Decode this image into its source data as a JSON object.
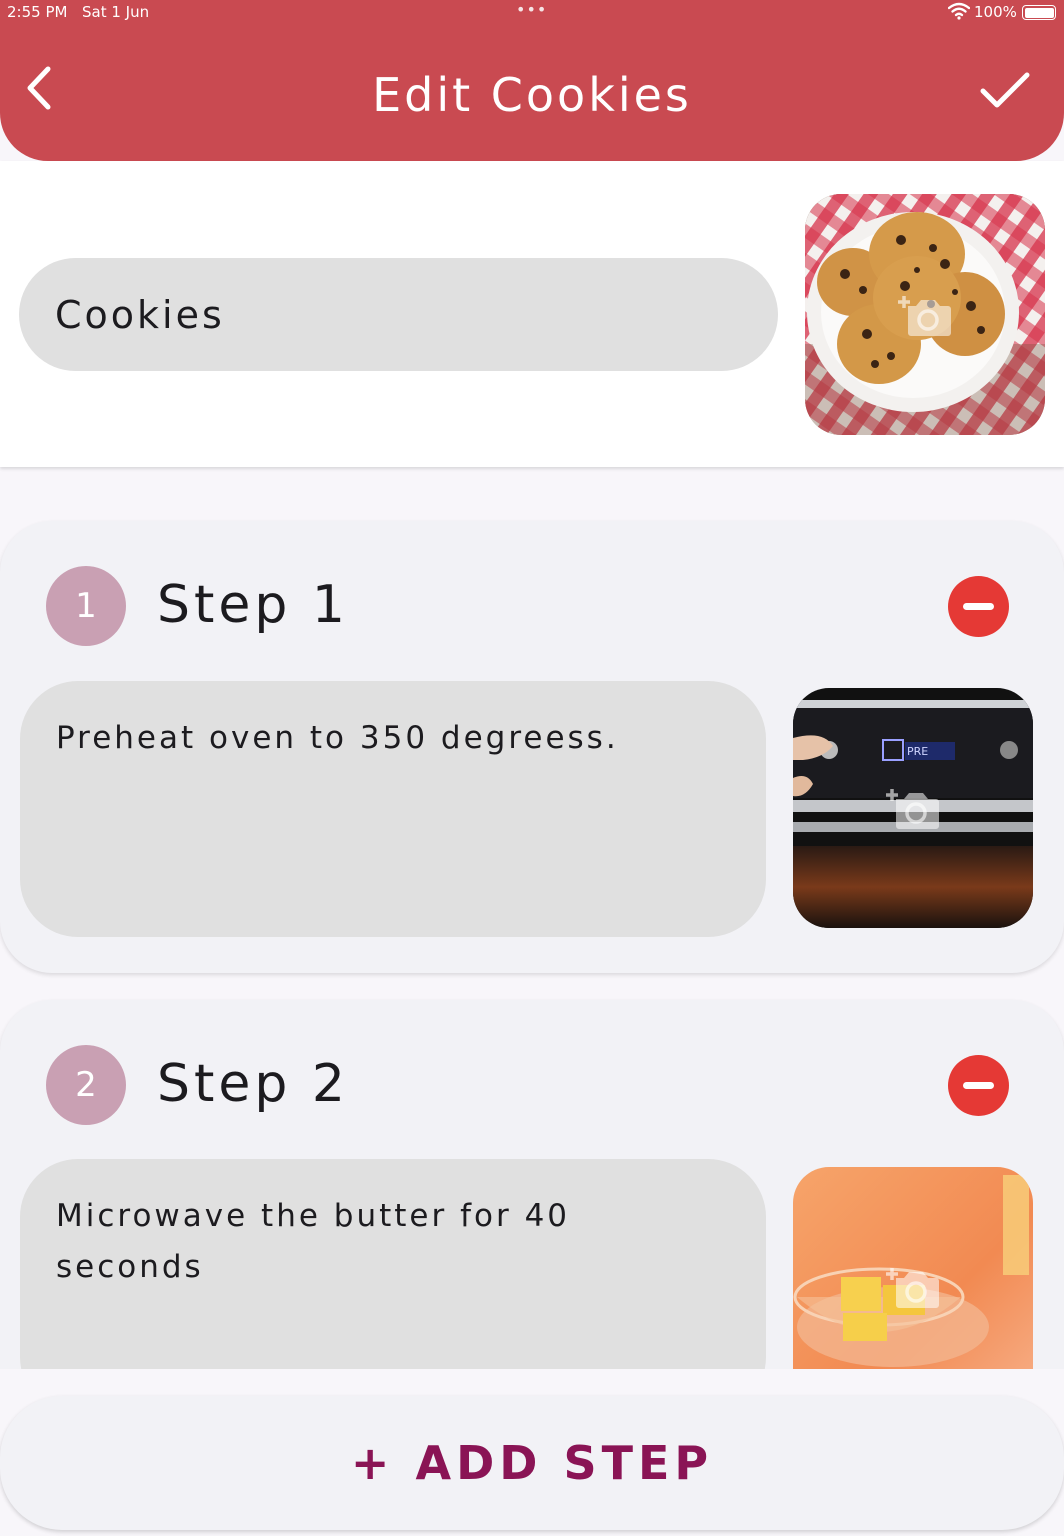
{
  "status_bar": {
    "time": "2:55 PM",
    "date": "Sat 1 Jun",
    "battery": "100%",
    "icons": [
      "wifi-icon",
      "battery-icon",
      "multitask-dots-icon"
    ]
  },
  "header": {
    "title": "Edit Cookies",
    "back_icon": "chevron-left-icon",
    "confirm_icon": "checkmark-icon"
  },
  "recipe": {
    "name": "Cookies",
    "photo_icon": "add-photo-icon"
  },
  "steps": [
    {
      "number": "1",
      "title": "Step 1",
      "text": "Preheat oven to 350 degreess."
    },
    {
      "number": "2",
      "title": "Step 2",
      "text": "Microwave the butter for 40 seconds"
    }
  ],
  "add_step_label": "+ ADD STEP",
  "colors": {
    "header": "#c94a51",
    "step_badge": "#c9a0b3",
    "remove": "#e53935",
    "add_step_text": "#8a1455",
    "input_fill": "#e0e0e0",
    "card": "#f2f2f6"
  }
}
